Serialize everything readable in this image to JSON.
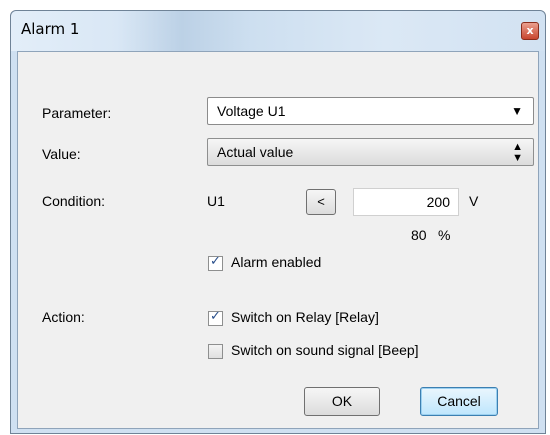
{
  "window": {
    "title": "Alarm 1",
    "close_glyph": "x"
  },
  "form": {
    "parameter_label": "Parameter:",
    "parameter_value": "Voltage U1",
    "value_label": "Value:",
    "value_value": "Actual value",
    "condition_label": "Condition:",
    "condition_param": "U1",
    "comparator": "<",
    "threshold_value": "200",
    "threshold_unit": "V",
    "percent_value": "80",
    "percent_unit": "%",
    "alarm_enabled_label": "Alarm enabled",
    "alarm_enabled": true,
    "action_label": "Action:",
    "action_relay_label": "Switch on Relay [Relay]",
    "action_relay": true,
    "action_beep_label": "Switch on sound signal [Beep]",
    "action_beep": false
  },
  "buttons": {
    "ok": "OK",
    "cancel": "Cancel"
  },
  "icons": {
    "parameter_dropdown": "chevron-down-icon",
    "value_spinner": "up-down-arrows-icon",
    "close": "close-icon"
  },
  "colors": {
    "accent": "#3c7fb1",
    "close_button": "#c8462f",
    "check_mark": "#294f8b"
  }
}
